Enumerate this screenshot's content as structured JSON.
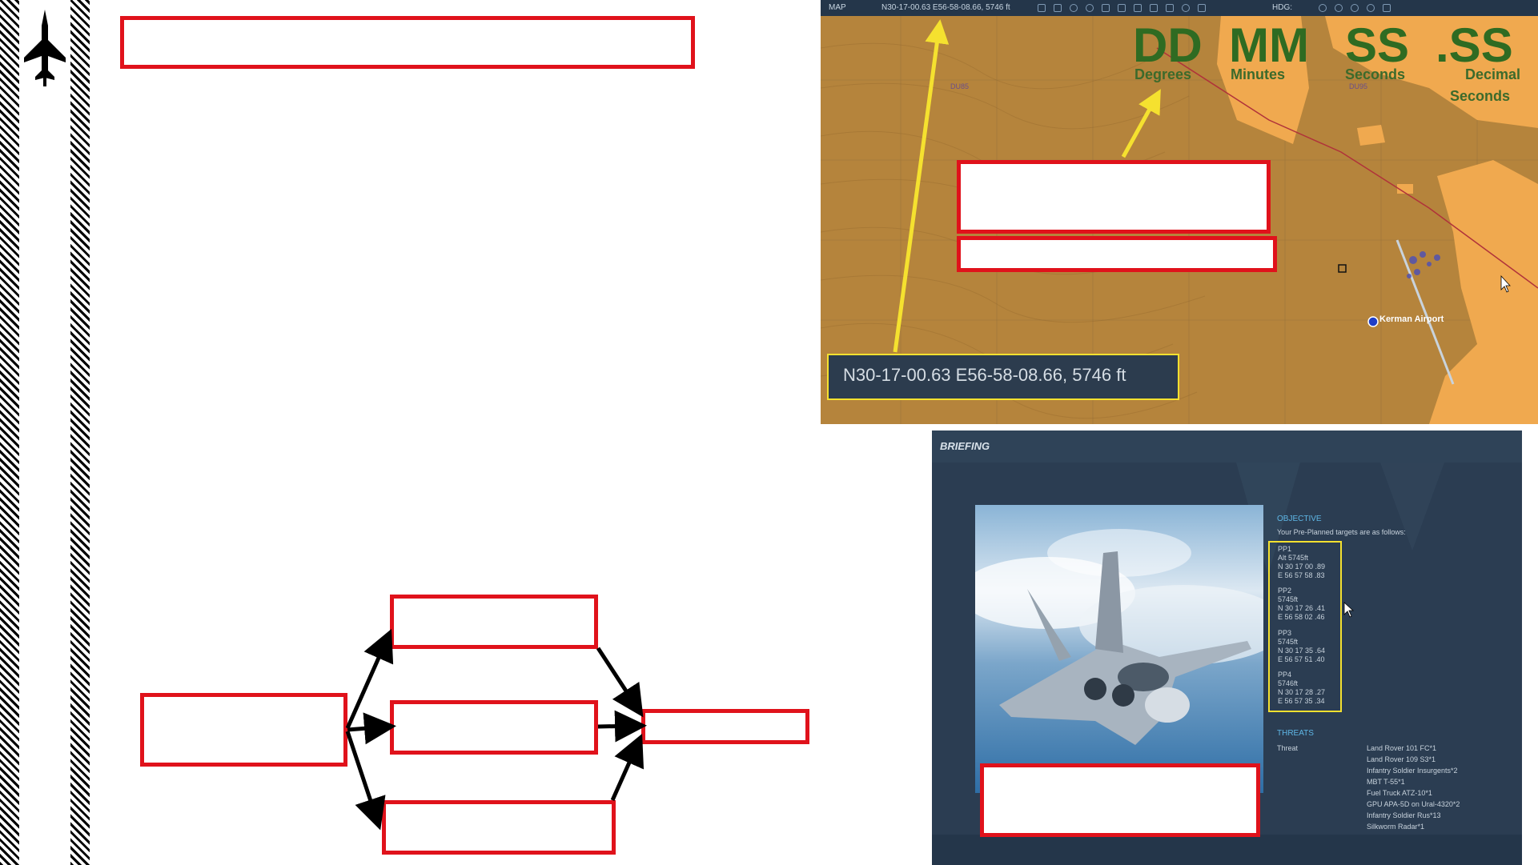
{
  "map": {
    "tab_label": "MAP",
    "top_coord": "N30-17-00.63 E56-58-08.66, 5746 ft",
    "hdg_label": "HDG:",
    "dms": {
      "dd": "DD",
      "mm": "MM",
      "ss": "SS",
      "dss": ".SS",
      "degrees": "Degrees",
      "minutes": "Minutes",
      "seconds": "Seconds",
      "decimal": "Decimal",
      "decimal_seconds": "Seconds"
    },
    "coord_popup": "N30-17-00.63 E56-58-08.66, 5746 ft",
    "airport": "Kerman Airport",
    "grid_labels": [
      "DU85",
      "DU95"
    ]
  },
  "briefing": {
    "title": "BRIEFING",
    "objective_heading": "OBJECTIVE",
    "objective_intro": "Your Pre-Planned targets are as follows:",
    "points": [
      {
        "name": "PP1",
        "alt": "Alt 5745ft",
        "lat": "N 30 17 00 .89",
        "lon": "E 56 57 58 .83"
      },
      {
        "name": "PP2",
        "alt": "5745ft",
        "lat": "N 30 17 26 .41",
        "lon": "E 56 58 02 .46"
      },
      {
        "name": "PP3",
        "alt": "5745ft",
        "lat": "N 30 17 35 .64",
        "lon": "E 56 57 51 .40"
      },
      {
        "name": "PP4",
        "alt": "5746ft",
        "lat": "N 30 17 28 .27",
        "lon": "E 56 57 35 .34"
      }
    ],
    "threats_heading": "THREATS",
    "threat_label": "Threat",
    "threats": [
      "Land Rover 101 FC*1",
      "Land Rover 109 S3*1",
      "Infantry Soldier Insurgents*2",
      "MBT T-55*1",
      "Fuel Truck ATZ-10*1",
      "GPU APA-5D on Ural-4320*2",
      "Infantry Soldier Rus*13",
      "Silkworm Radar*1"
    ]
  },
  "colors": {
    "redact_red": "#e0121b",
    "highlight_yellow": "#f5e12f",
    "map_tan": "#b5843c",
    "panel_navy": "#2b3d52"
  },
  "icons": [
    "fighter-jet-icon",
    "mouse-cursor-icon"
  ]
}
